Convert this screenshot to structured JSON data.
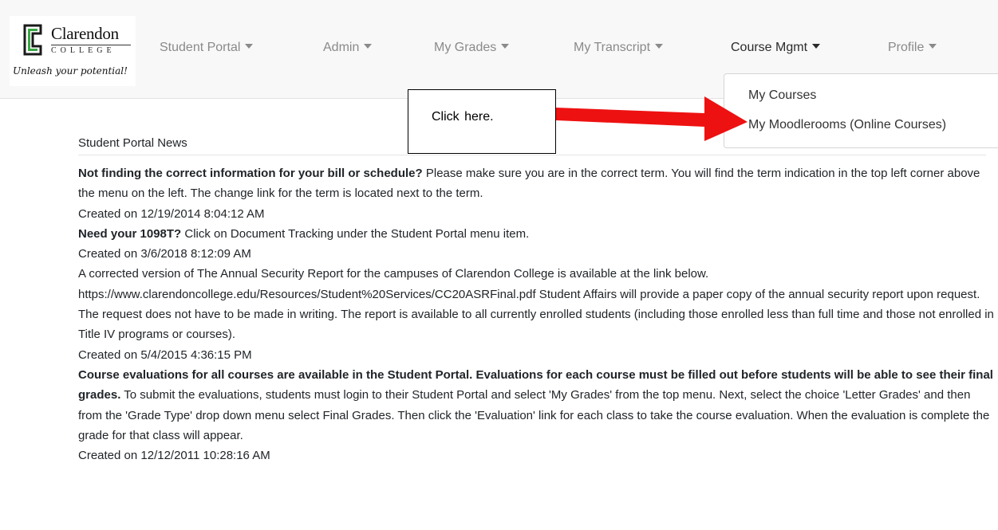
{
  "logo": {
    "name": "Clarendon",
    "college": "COLLEGE",
    "tagline": "Unleash your potential!"
  },
  "nav": {
    "items": [
      {
        "label": "Student Portal"
      },
      {
        "label": "Admin"
      },
      {
        "label": "My Grades"
      },
      {
        "label": "My Transcript"
      },
      {
        "label": "Course Mgmt"
      },
      {
        "label": "Profile"
      }
    ],
    "active": "Course Mgmt"
  },
  "dropdown": {
    "items": [
      {
        "label": "My Courses"
      },
      {
        "label": "My Moodlerooms (Online Courses)"
      }
    ]
  },
  "callout": {
    "text": "Click here.",
    "arrow_color": "#ee1111"
  },
  "news": {
    "title": "Student Portal News",
    "items": [
      {
        "bold": "Not finding the correct information for your bill or schedule?",
        "text": " Please make sure you are in the correct term. You will find the term indication in the top left corner above the menu on the left. The change link for the term is located next to the term.",
        "created": "Created on 12/19/2014 8:04:12 AM"
      },
      {
        "bold": "Need your 1098T?",
        "text": " Click on Document Tracking under the Student Portal menu item.",
        "created": "Created on 3/6/2018 8:12:09 AM"
      },
      {
        "bold": "",
        "text": "A corrected version of The Annual Security Report for the campuses of Clarendon College is available at the link below. https://www.clarendoncollege.edu/Resources/Student%20Services/CC20ASRFinal.pdf Student Affairs will provide a paper copy of the annual security report upon request. The request does not have to be made in writing. The report is available to all currently enrolled students (including those enrolled less than full time and those not enrolled in Title IV programs or courses).",
        "created": "Created on 5/4/2015 4:36:15 PM"
      },
      {
        "bold": "Course evaluations for all courses are available in the Student Portal. Evaluations for each course must be filled out before students will be able to see their final grades.",
        "text": " To submit the evaluations, students must login to their Student Portal and select 'My Grades' from the top menu. Next, select the choice 'Letter Grades' and then from the 'Grade Type' drop down menu select Final Grades. Then click the 'Evaluation' link for each class to take the course evaluation. When the evaluation is complete the grade for that class will appear.",
        "created": "Created on 12/12/2011 10:28:16 AM"
      }
    ]
  }
}
